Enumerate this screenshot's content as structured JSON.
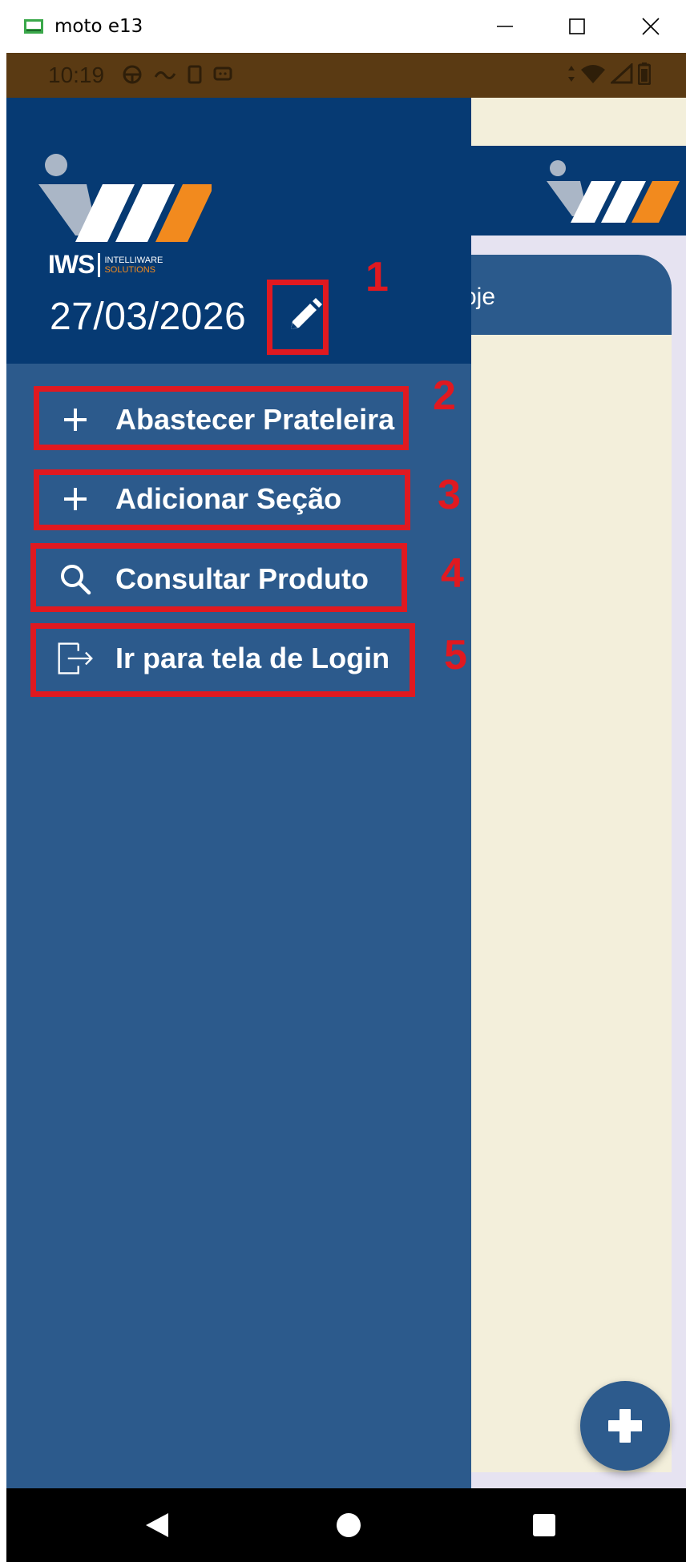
{
  "window": {
    "title": "moto e13",
    "minimize_icon": "minimize-icon",
    "maximize_icon": "maximize-icon",
    "close_icon": "close-icon"
  },
  "status_bar": {
    "time": "10:19",
    "left_icons": [
      "steering-wheel-icon",
      "signal-text-icon",
      "sim-icon",
      "message-icon"
    ],
    "right_icons": [
      "wifi-icon",
      "cellular-icon",
      "battery-icon"
    ]
  },
  "background_screen": {
    "card_title_partial": "oje",
    "fab_icon": "plus-icon"
  },
  "drawer": {
    "logo": {
      "brand": "IWS",
      "line1": "INTELLIWARE",
      "line2": "SOLUTIONS"
    },
    "date": "27/03/2026",
    "edit_icon": "pencil-icon",
    "menu": [
      {
        "label": "Abastecer Prateleira",
        "icon": "plus-icon"
      },
      {
        "label": "Adicionar Seção",
        "icon": "plus-icon"
      },
      {
        "label": "Consultar Produto",
        "icon": "search-icon"
      },
      {
        "label": "Ir para tela de Login",
        "icon": "logout-icon"
      }
    ]
  },
  "annotations": [
    "1",
    "2",
    "3",
    "4",
    "5"
  ],
  "nav_bar": {
    "back_icon": "back-triangle-icon",
    "home_icon": "home-circle-icon",
    "recents_icon": "recents-square-icon"
  },
  "colors": {
    "drawer_header": "#063a73",
    "drawer_body": "#2c5a8c",
    "accent_orange": "#f28a1e",
    "annotation_red": "#e01920",
    "background_cream": "#f3efdb"
  }
}
